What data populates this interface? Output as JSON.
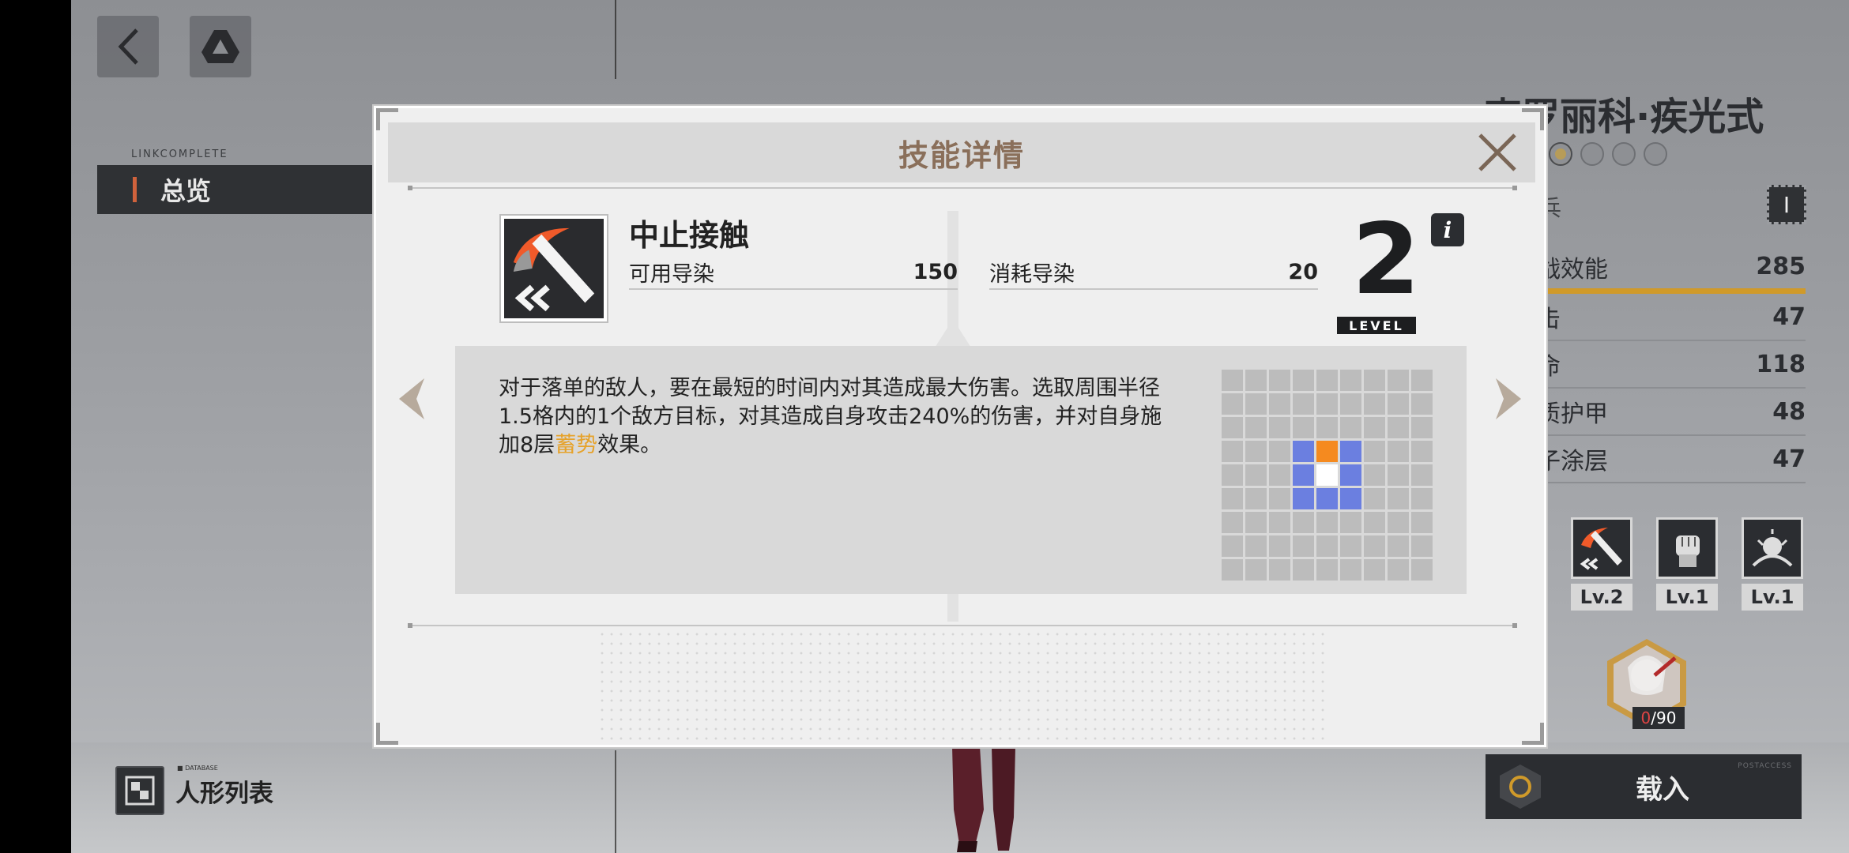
{
  "background": {
    "linkcomplete_label": "LINKCOMPLETE",
    "overview_tab": "总览",
    "char_list_tiny": "■ DATABASE",
    "char_list_label": "人形列表"
  },
  "character": {
    "name": "克罗丽科·疾光式",
    "class_text": "兵",
    "class_badge": "I",
    "stats": [
      {
        "label": "战效能",
        "value": "285"
      },
      {
        "label": "击",
        "value": "47"
      },
      {
        "label": "命",
        "value": "118"
      },
      {
        "label": "质护甲",
        "value": "48"
      },
      {
        "label": "子涂层",
        "value": "47"
      }
    ],
    "skills": [
      {
        "icon": "sword-icon",
        "level": "Lv.2"
      },
      {
        "icon": "fist-icon",
        "level": "Lv.1"
      },
      {
        "icon": "burst-icon",
        "level": "Lv.1"
      }
    ],
    "avatar_count_current": "0",
    "avatar_count_total": "/90",
    "load_button": "载入",
    "load_button_tiny": "POSTACCESS"
  },
  "modal": {
    "title": "技能详情",
    "skill_name": "中止接触",
    "available_label": "可用导染",
    "available_value": "150",
    "cost_label": "消耗导染",
    "cost_value": "20",
    "level_value": "2",
    "level_label": "LEVEL",
    "info_label": "i",
    "description_part1": "对于落单的敌人，要在最短的时间内对其造成最大伤害。选取周围半径1.5格内的1个敌方目标，对其造成自身攻击240%的伤害，并对自身施加8层",
    "description_highlight": "蓄势",
    "description_part2": "效果。",
    "range_grid": {
      "rows": 9,
      "cols": 9,
      "center": [
        4,
        4
      ],
      "blue_cells": [
        [
          3,
          3
        ],
        [
          3,
          5
        ],
        [
          4,
          3
        ],
        [
          4,
          5
        ],
        [
          5,
          3
        ],
        [
          5,
          4
        ],
        [
          5,
          5
        ]
      ],
      "orange_cells": [
        [
          3,
          4
        ]
      ],
      "white_cells": [
        [
          4,
          4
        ]
      ]
    }
  },
  "colors": {
    "title_brown": "#8a6f5a",
    "highlight_orange": "#e6a22a",
    "grid_blue": "#6b7fe0",
    "grid_orange": "#f58a1f",
    "stat_accent": "#d09a2a"
  }
}
